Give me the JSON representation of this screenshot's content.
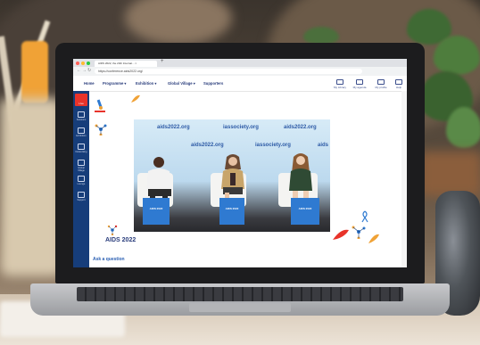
{
  "browser": {
    "tab_title": "AIDS 2022, the 24th Internat... ×",
    "url": "https://conference.aids2022.org/"
  },
  "site_nav": {
    "items": [
      "Home",
      "Programme ▾",
      "Exhibition ▾",
      "Global Village ▾",
      "Supporters"
    ],
    "right_items": [
      "My Library",
      "My agenda",
      "My profile",
      "Help"
    ]
  },
  "rail": {
    "live_label": "Live",
    "items": [
      "Sessions",
      "Exhibition",
      "Networking",
      "Global Village",
      "Lounge",
      "Support"
    ]
  },
  "stream": {
    "backdrop_texts": [
      "aids2022.org",
      "iassociety.org",
      "aids2022.org",
      "iassociety.org",
      "aids2022.org",
      "aids"
    ],
    "podium_labels": [
      "AIDS 2022",
      "AIDS 2022",
      "AIDS 2022"
    ]
  },
  "footer": {
    "logo_text": "AIDS 2022",
    "ask_label": "Ask a question"
  },
  "colors": {
    "brand_navy": "#163d7a",
    "live_red": "#e8332a",
    "podium_blue": "#2f7ad1"
  }
}
